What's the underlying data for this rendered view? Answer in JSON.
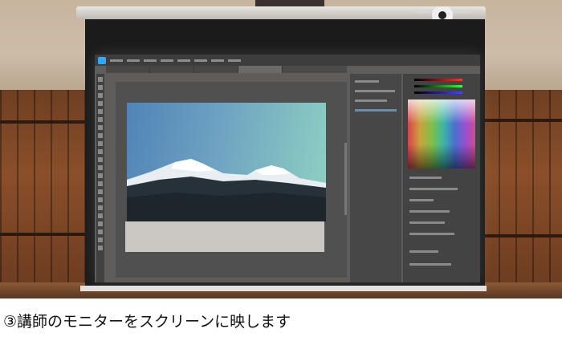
{
  "photo": {
    "screen_app": "adobe-photoshop-window",
    "projected_image_subject": "snow-capped-mountains"
  },
  "caption": {
    "text": "③講師のモニターをスクリーンに映します"
  },
  "colors": {
    "caption_text": "#111111",
    "ps_accent": "#31a8ff",
    "wood_wall": "#7a4627"
  }
}
